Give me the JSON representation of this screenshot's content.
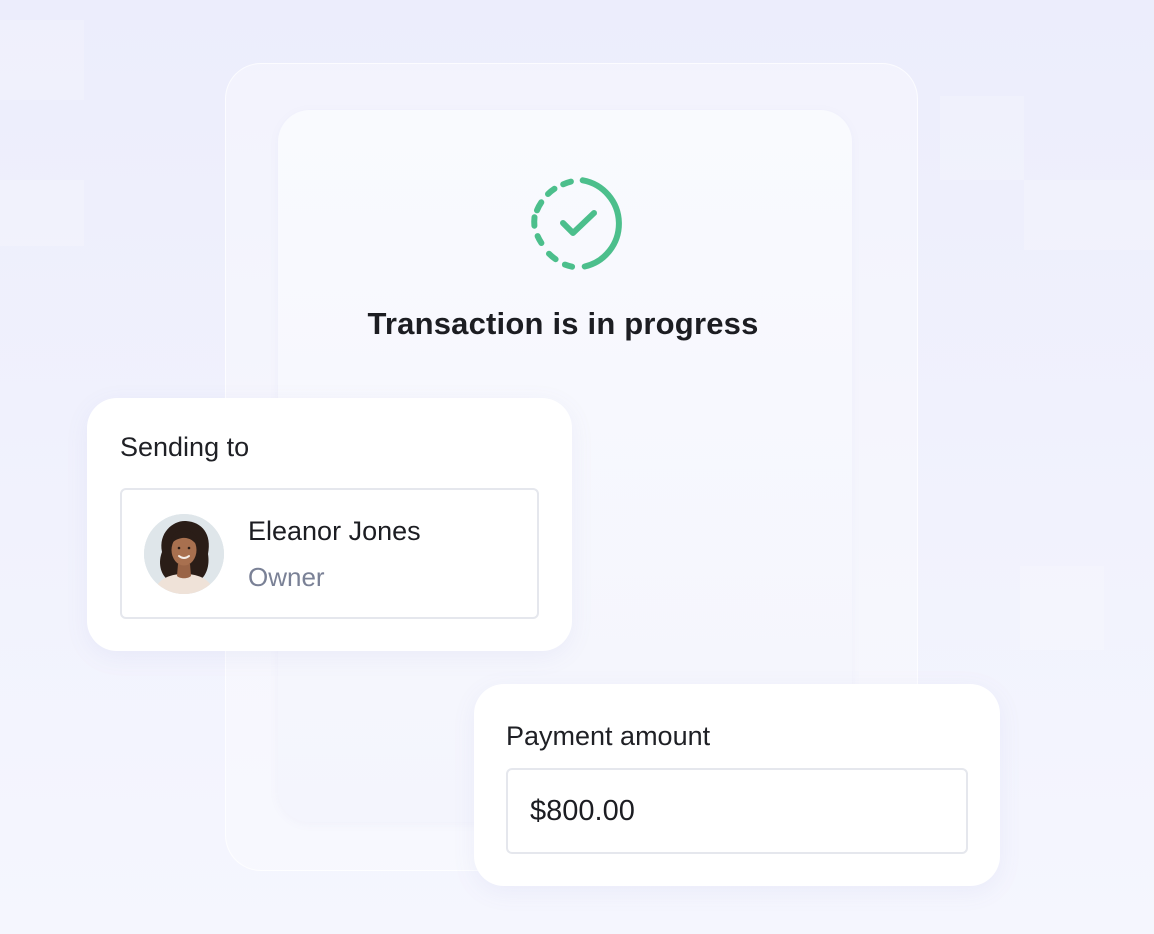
{
  "status": {
    "icon": "dashed-circle-check-icon",
    "title": "Transaction is in progress",
    "accent_color": "#4cbf8c"
  },
  "sending_to": {
    "label": "Sending to",
    "recipient": {
      "name": "Eleanor Jones",
      "role": "Owner",
      "avatar": "person-avatar"
    }
  },
  "payment": {
    "label": "Payment amount",
    "amount": "$800.00"
  }
}
